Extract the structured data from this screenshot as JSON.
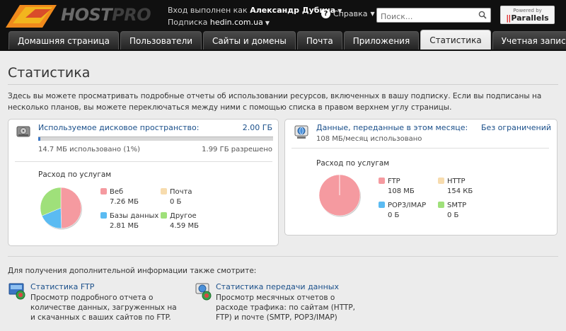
{
  "header": {
    "logo_text_a": "HOST",
    "logo_text_b": "PRO",
    "logged_in_label": "Вход выполнен как",
    "user_name": "Александр Дубина",
    "subscription_label": "Подписка",
    "subscription_domain": "hedin.com.ua",
    "help_label": "Справка",
    "search_placeholder": "Поиск...",
    "powered_by": "Powered by",
    "parallels": "Parallels"
  },
  "tabs": [
    {
      "label": "Домашняя страница",
      "active": false
    },
    {
      "label": "Пользователи",
      "active": false
    },
    {
      "label": "Сайты и домены",
      "active": false
    },
    {
      "label": "Почта",
      "active": false
    },
    {
      "label": "Приложения",
      "active": false
    },
    {
      "label": "Статистика",
      "active": true
    },
    {
      "label": "Учетная запись",
      "active": false
    }
  ],
  "page": {
    "title": "Статистика",
    "intro": "Здесь вы можете просматривать подробные отчеты об использовании ресурсов, включенных в вашу подписку. Если вы подписаны на несколько планов, вы можете переключаться между ними с помощью списка в правом верхнем углу страницы."
  },
  "disk": {
    "title": "Используемое дисковое пространство:",
    "total": "2.00 ГБ",
    "used": "14.7 МБ использовано (1%)",
    "allowed": "1.99 ГБ разрешено",
    "used_fraction": 0.01,
    "services_title": "Расход по услугам",
    "legend": [
      {
        "name": "Веб",
        "value": "7.26 МБ",
        "color": "#f59aa0"
      },
      {
        "name": "Почта",
        "value": "0 Б",
        "color": "#f7dcae"
      },
      {
        "name": "Базы данных",
        "value": "2.81 МБ",
        "color": "#5bbbf2"
      },
      {
        "name": "Другое",
        "value": "4.59 МБ",
        "color": "#9fe07a"
      }
    ]
  },
  "traffic": {
    "title": "Данные, переданные в этом месяце:",
    "limit": "Без ограничений",
    "used": "108 МБ/месяц использовано",
    "services_title": "Расход по услугам",
    "legend": [
      {
        "name": "FTP",
        "value": "108 МБ",
        "color": "#f59aa0"
      },
      {
        "name": "HTTP",
        "value": "154 КБ",
        "color": "#f7dcae"
      },
      {
        "name": "POP3/IMAP",
        "value": "0 Б",
        "color": "#5bbbf2"
      },
      {
        "name": "SMTP",
        "value": "0 Б",
        "color": "#9fe07a"
      }
    ]
  },
  "more": {
    "title": "Для получения дополнительной информации также смотрите:",
    "links": [
      {
        "title": "Статистика FTP",
        "desc": "Просмотр подробного отчета о количестве данных, загруженных на и скачанных с ваших сайтов по FTP."
      },
      {
        "title": "Статистика передачи данных",
        "desc": "Просмотр месячных отчетов о расходе трафика: по сайтам (HTTP, FTP) и почте (SMTP, POP3/IMAP)"
      }
    ]
  },
  "chart_data": [
    {
      "type": "pie",
      "categories": [
        "Веб",
        "Почта",
        "Базы данных",
        "Другое"
      ],
      "values": [
        7.26,
        0,
        2.81,
        4.59
      ],
      "colors": [
        "#f59aa0",
        "#f7dcae",
        "#5bbbf2",
        "#9fe07a"
      ]
    },
    {
      "type": "pie",
      "categories": [
        "FTP",
        "HTTP",
        "POP3/IMAP",
        "SMTP"
      ],
      "values": [
        108,
        0.15,
        0,
        0
      ],
      "colors": [
        "#f59aa0",
        "#f7dcae",
        "#5bbbf2",
        "#9fe07a"
      ]
    }
  ]
}
